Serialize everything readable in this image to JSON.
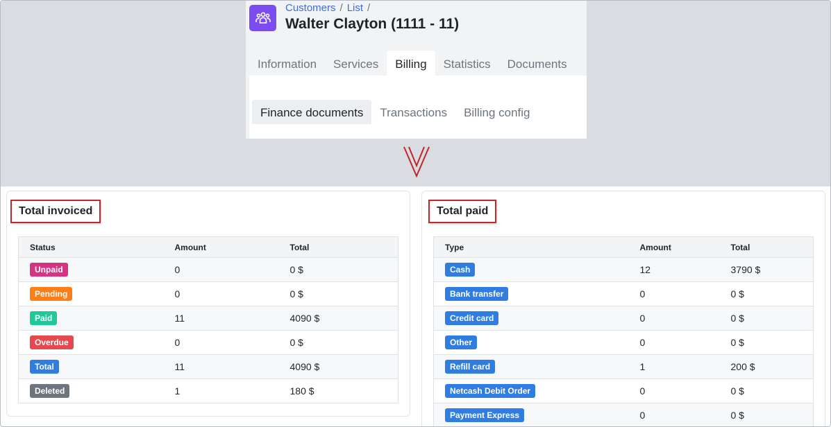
{
  "header": {
    "breadcrumb": [
      "Customers",
      "List"
    ],
    "title": "Walter Clayton (1111 - 11)",
    "tabs": [
      "Information",
      "Services",
      "Billing",
      "Statistics",
      "Documents"
    ],
    "active_tab": "Billing",
    "subtabs": [
      "Finance documents",
      "Transactions",
      "Billing config"
    ],
    "active_subtab": "Finance documents",
    "icon": "customers-icon"
  },
  "total_invoiced": {
    "title": "Total invoiced",
    "columns": [
      "Status",
      "Amount",
      "Total"
    ],
    "rows": [
      {
        "status": "Unpaid",
        "color": "#d63384",
        "amount": "0",
        "total": "0 $"
      },
      {
        "status": "Pending",
        "color": "#fd7e14",
        "amount": "0",
        "total": "0 $"
      },
      {
        "status": "Paid",
        "color": "#20c997",
        "amount": "11",
        "total": "4090 $"
      },
      {
        "status": "Overdue",
        "color": "#e5484d",
        "amount": "0",
        "total": "0 $"
      },
      {
        "status": "Total",
        "color": "#2f7de1",
        "amount": "11",
        "total": "4090 $"
      },
      {
        "status": "Deleted",
        "color": "#6c757d",
        "amount": "1",
        "total": "180 $"
      }
    ]
  },
  "total_paid": {
    "title": "Total paid",
    "columns": [
      "Type",
      "Amount",
      "Total"
    ],
    "rows": [
      {
        "type": "Cash",
        "amount": "12",
        "total": "3790 $"
      },
      {
        "type": "Bank transfer",
        "amount": "0",
        "total": "0 $"
      },
      {
        "type": "Credit card",
        "amount": "0",
        "total": "0 $"
      },
      {
        "type": "Other",
        "amount": "0",
        "total": "0 $"
      },
      {
        "type": "Refill card",
        "amount": "1",
        "total": "200 $"
      },
      {
        "type": "Netcash Debit Order",
        "amount": "0",
        "total": "0 $"
      },
      {
        "type": "Payment Express",
        "amount": "0",
        "total": "0 $"
      }
    ],
    "badge_color": "#2f7de1"
  },
  "colors": {
    "accent": "#7b4df0",
    "link": "#3b6fd8",
    "highlight_border": "#c0262d"
  }
}
